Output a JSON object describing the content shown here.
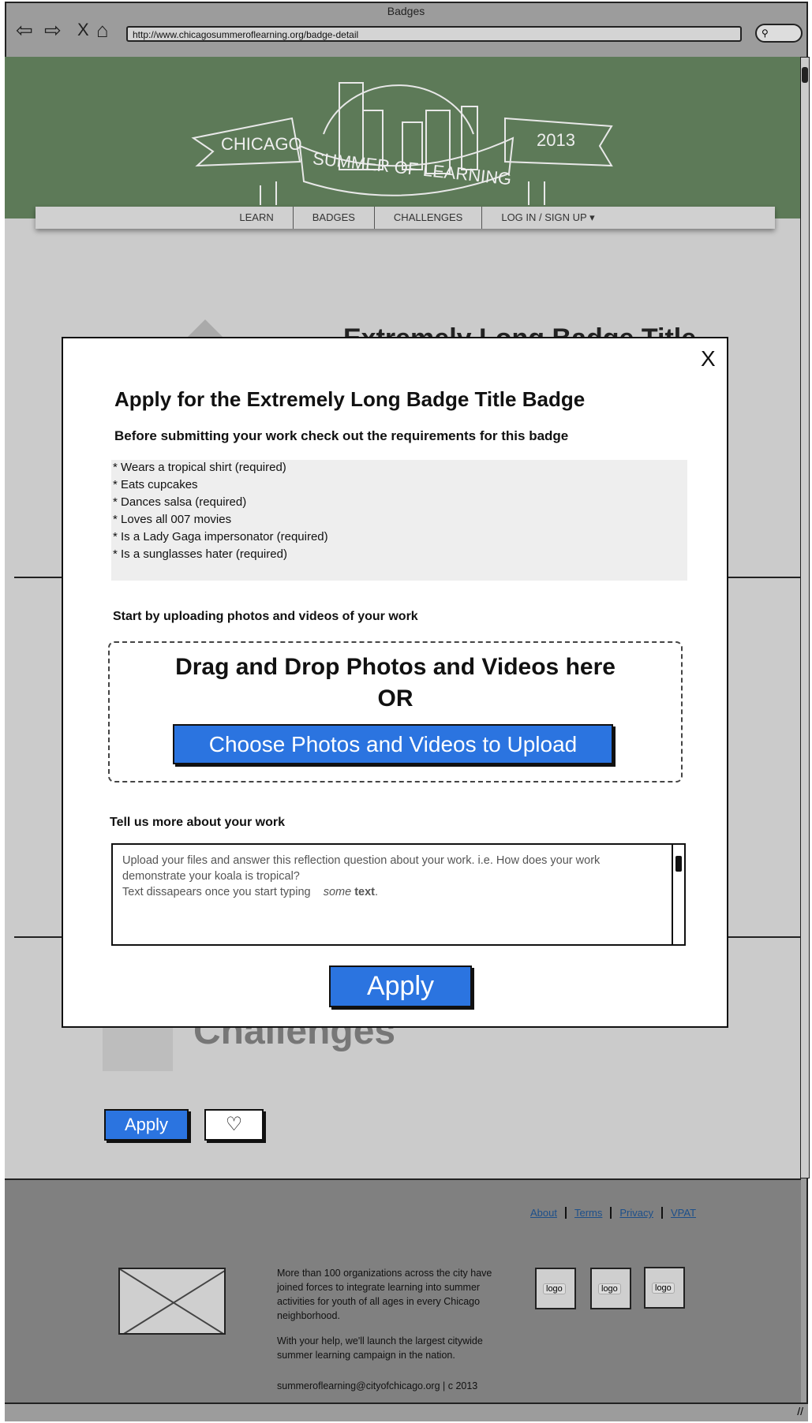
{
  "browser": {
    "title": "Badges",
    "url": "http://www.chicagosummeroflearning.org/badge-detail",
    "stop_label": "X"
  },
  "banner": {
    "left_ribbon": "CHICAGO",
    "center_ribbon": "SUMMER OF LEARNING",
    "right_ribbon": "2013"
  },
  "nav": {
    "items": [
      "LEARN",
      "BADGES",
      "CHALLENGES",
      "LOG IN / SIGN UP ▾"
    ]
  },
  "background_page": {
    "badge_title": "Extremely Long Badge Title",
    "challenges_heading": "Challenges",
    "apply_label": "Apply",
    "favorite_icon": "heart-icon"
  },
  "modal": {
    "close_label": "X",
    "title": "Apply for the Extremely Long Badge Title Badge",
    "requirements_intro": "Before submitting your work check out the requirements for this badge",
    "requirements": [
      "* Wears a tropical shirt (required)",
      "* Eats cupcakes",
      "* Dances salsa  (required)",
      "* Loves all 007 movies",
      "* Is a Lady Gaga impersonator (required)",
      "* Is a sunglasses hater (required)"
    ],
    "upload_intro": "Start by uploading photos and videos of your work",
    "drop_text": "Drag and Drop Photos and Videos here",
    "or_text": "OR",
    "choose_button": "Choose Photos and Videos to Upload",
    "tell_more": "Tell us more about your work",
    "textarea": {
      "line1": "Upload your files and answer this reflection question about your work. i.e. How does your work demonstrate your koala is tropical?",
      "line2": "Text dissapears once you start typing",
      "italic": "some",
      "bold": "text",
      "end": "."
    },
    "apply_button": "Apply",
    "accent": "#2b74e0"
  },
  "footer": {
    "links": [
      "About",
      "Terms",
      "Privacy",
      "VPAT"
    ],
    "paragraph1": "More than 100 organizations across the city have joined forces to integrate learning into summer activities for youth of all ages in every Chicago neighborhood.",
    "paragraph2": "With your help, we'll launch the largest citywide summer learning campaign in the nation.",
    "contact": "summeroflearning@cityofchicago.org | c 2013",
    "logos": [
      "logo",
      "logo",
      "logo"
    ]
  }
}
